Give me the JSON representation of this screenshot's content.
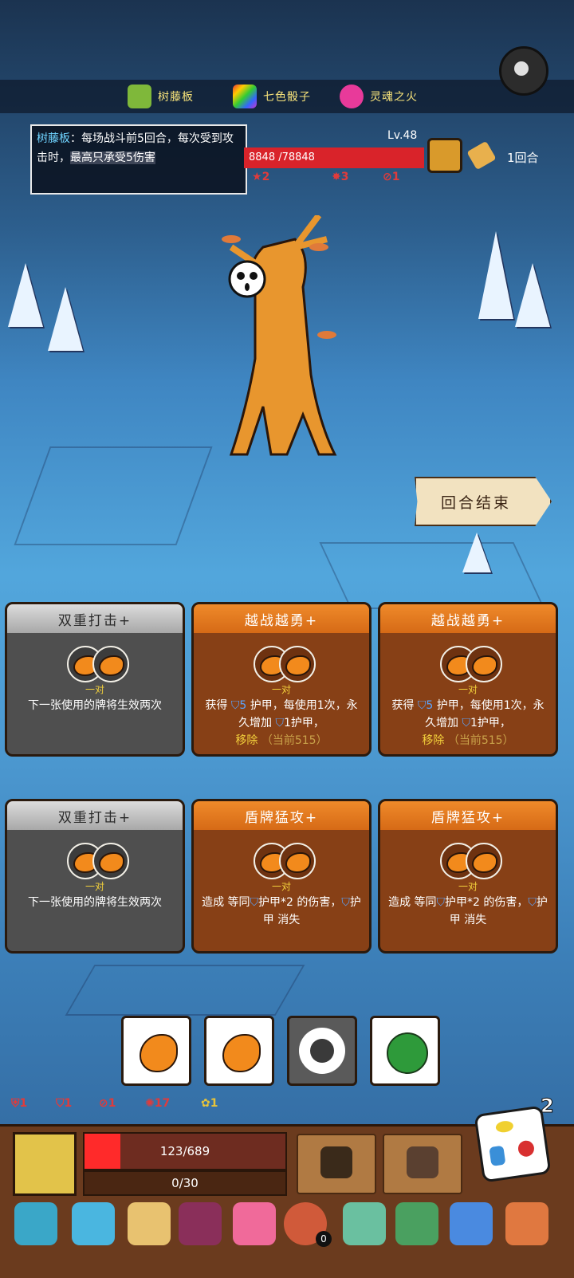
{
  "relics": [
    {
      "name": "树藤板",
      "icon": "vine-board-icon",
      "color": "#7fb83a"
    },
    {
      "name": "七色骰子",
      "icon": "rainbow-dice-icon",
      "color": "#c84ad0"
    },
    {
      "name": "灵魂之火",
      "icon": "soul-fire-icon",
      "color": "#e83a9a"
    }
  ],
  "tooltip": {
    "name": "树藤板",
    "text_a": "：每场战斗前5回合，每次受到攻击时，",
    "text_b": "最高只承受5伤害"
  },
  "enemy": {
    "level": "Lv.48",
    "hp_text": "8848 /78848",
    "hp_fraction": 1.0,
    "stats": [
      "1",
      "1",
      "2",
      "1",
      "3",
      "1"
    ],
    "rounds": "1回合"
  },
  "end_turn": "回合结束",
  "cards": [
    {
      "title": "双重打击+",
      "pair": "一对",
      "desc": "下一张使用的牌将生效两次",
      "style": "gray"
    },
    {
      "title": "越战越勇+",
      "pair": "一对",
      "desc_a": "获得 ",
      "num": "5",
      "desc_b": " 护甲，每使用1次，永久增加 ",
      "desc_c": "1护甲，",
      "remove": "移除",
      "current": "（当前515）",
      "style": "orange"
    },
    {
      "title": "越战越勇+",
      "pair": "一对",
      "desc_a": "获得 ",
      "num": "5",
      "desc_b": " 护甲，每使用1次，永久增加 ",
      "desc_c": "1护甲，",
      "remove": "移除",
      "current": "（当前515）",
      "style": "orange"
    },
    {
      "title": "双重打击+",
      "pair": "一对",
      "desc": "下一张使用的牌将生效两次",
      "style": "gray"
    },
    {
      "title": "盾牌猛攻+",
      "pair": "一对",
      "desc_a": "造成 等同",
      "desc_b": "护甲*2 的伤害，",
      "desc_c": "护甲 消失",
      "style": "orange"
    },
    {
      "title": "盾牌猛攻+",
      "pair": "一对",
      "desc_a": "造成 等同",
      "desc_b": "护甲*2 的伤害，",
      "desc_c": "护甲 消失",
      "style": "orange"
    }
  ],
  "player_stats": [
    "1",
    "1",
    "1",
    "17",
    "1"
  ],
  "dice_count": "2",
  "player": {
    "hp_text": "123/689",
    "hp_fraction": 0.18,
    "shield_text": "0/30"
  },
  "inventory_badge": "0",
  "colors": {
    "accent": "#f28a1c",
    "hp": "#ff2a2a",
    "card_orange": "#874016"
  }
}
